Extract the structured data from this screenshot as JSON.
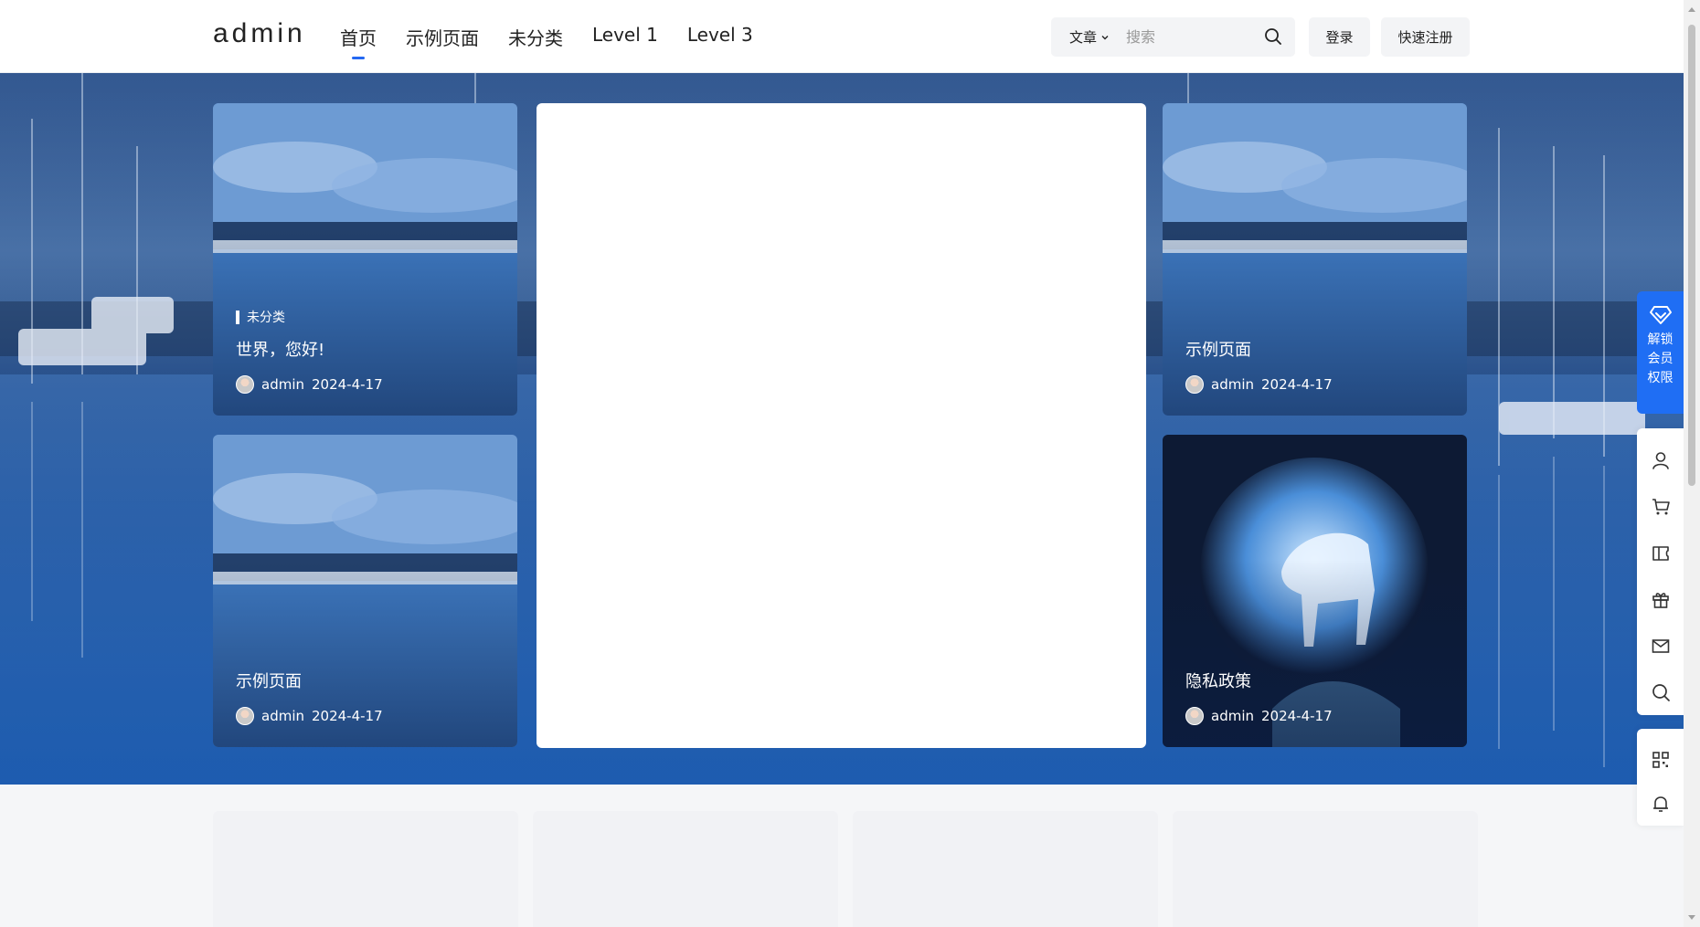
{
  "header": {
    "logo": "admin",
    "nav": [
      {
        "label": "首页",
        "active": true
      },
      {
        "label": "示例页面"
      },
      {
        "label": "未分类"
      },
      {
        "label": "Level 1"
      },
      {
        "label": "Level 3"
      }
    ],
    "search": {
      "type_label": "文章",
      "placeholder": "搜索"
    },
    "login_label": "登录",
    "register_label": "快速注册"
  },
  "cards": [
    {
      "category": "未分类",
      "title": "世界，您好!",
      "author": "admin",
      "date": "2024-4-17"
    },
    {
      "title": "示例页面",
      "author": "admin",
      "date": "2024-4-17"
    },
    {
      "title": "示例页面",
      "author": "admin",
      "date": "2024-4-17"
    },
    {
      "title": "隐私政策",
      "author": "admin",
      "date": "2024-4-17"
    }
  ],
  "sidebar": {
    "vip_label": "解锁\n会员\n权限",
    "vip_lines": [
      "解锁",
      "会员",
      "权限"
    ],
    "tools": [
      "user-icon",
      "cart-icon",
      "ticket-icon",
      "gift-icon",
      "mail-icon",
      "search-icon",
      "qrcode-icon",
      "bell-icon"
    ]
  },
  "colors": {
    "accent": "#1f6ef4",
    "header_bg": "#ffffff",
    "page_bg": "#f5f6f8"
  }
}
